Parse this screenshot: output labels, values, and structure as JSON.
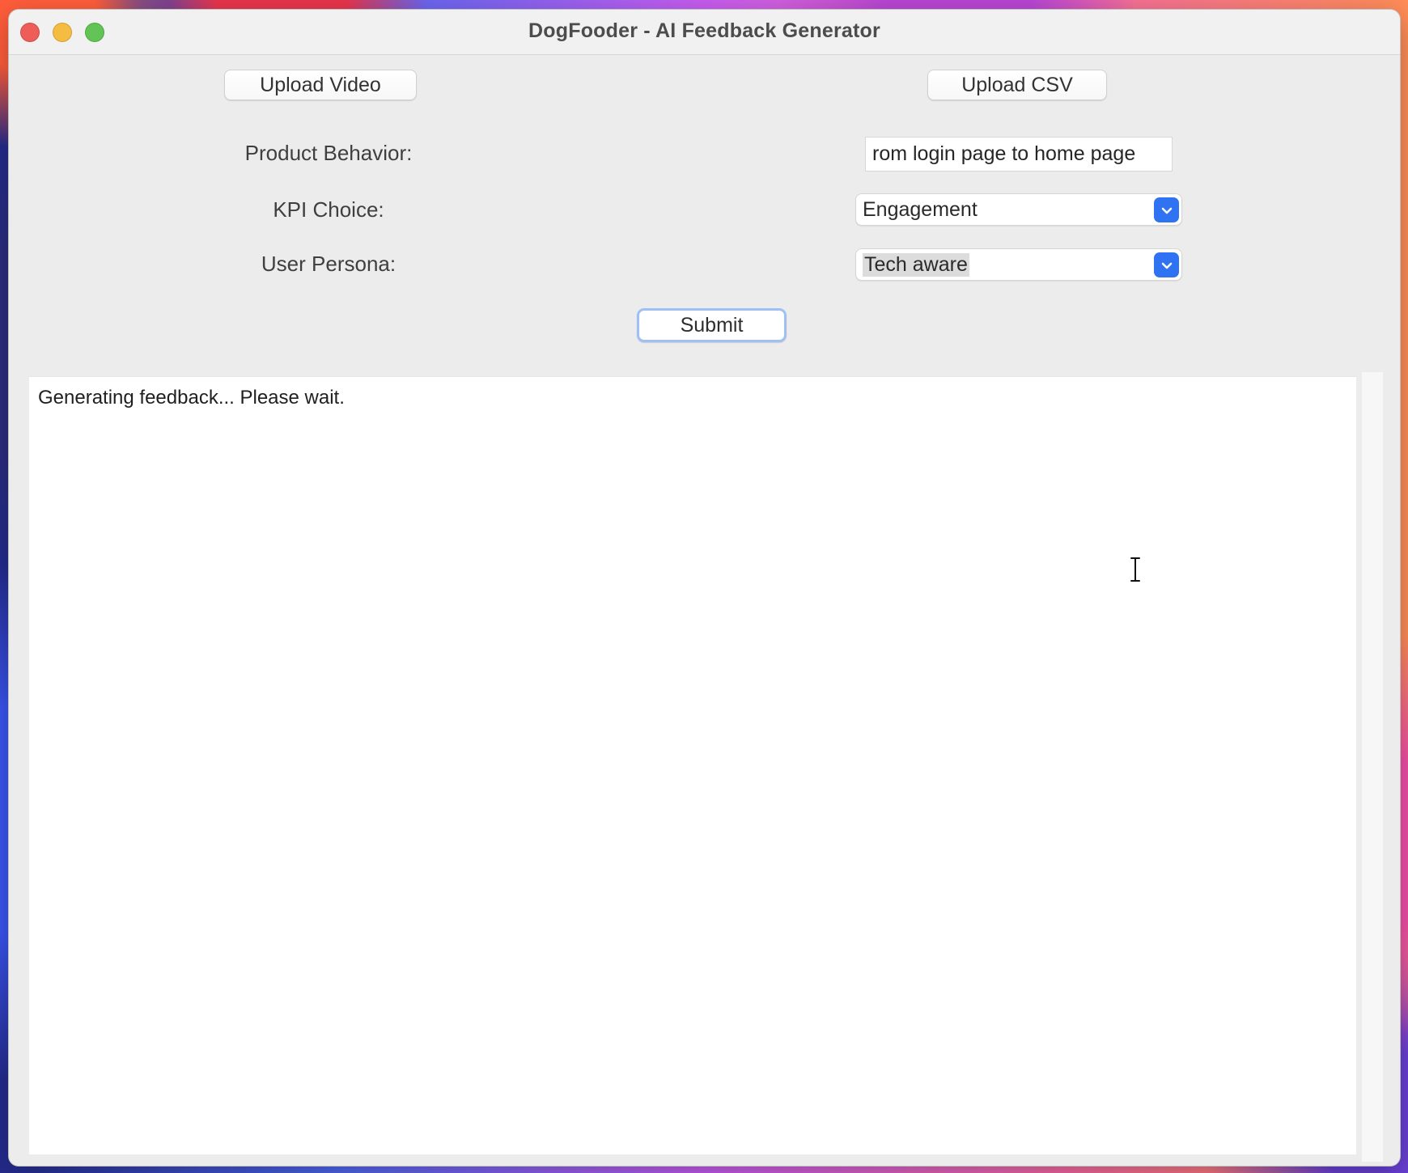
{
  "window": {
    "title": "DogFooder - AI Feedback Generator"
  },
  "toolbar": {
    "upload_video_label": "Upload Video",
    "upload_csv_label": "Upload CSV"
  },
  "form": {
    "product_behavior_label": "Product Behavior:",
    "product_behavior_value": "rom login page to home page",
    "kpi_choice_label": "KPI Choice:",
    "kpi_choice_value": "Engagement",
    "user_persona_label": "User Persona:",
    "user_persona_value": "Tech aware",
    "submit_label": "Submit"
  },
  "output": {
    "text": "Generating feedback... Please wait."
  },
  "icons": {
    "window_close": "close-icon",
    "window_minimize": "minimize-icon",
    "window_zoom": "zoom-icon",
    "dropdown": "chevron-down-icon",
    "mouse_cursor": "i-beam-cursor-icon"
  },
  "colors": {
    "close": "#ee5d57",
    "minimize": "#f4bd42",
    "zoom": "#62c454",
    "accent": "#2f73f2"
  }
}
